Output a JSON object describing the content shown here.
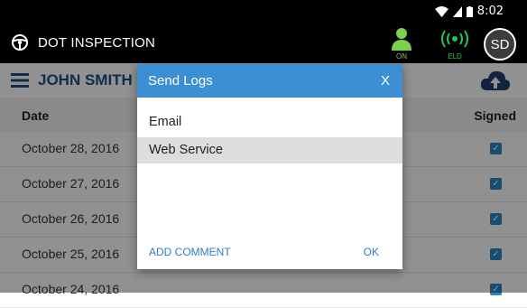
{
  "status_bar": {
    "time": "8:02",
    "icons": [
      "wifi-icon",
      "signal-icon",
      "battery-icon"
    ]
  },
  "app_bar": {
    "title": "DOT INSPECTION",
    "driver_status_label": "ON",
    "eld_label": "ELD",
    "avatar_initials": "SD",
    "colors": {
      "on_green": "#7ad14f",
      "eld_green": "#23c552"
    }
  },
  "toolbar": {
    "driver_name": "JOHN SMITH",
    "accent": "#1f4f86"
  },
  "table": {
    "headers": {
      "date": "Date",
      "signed": "Signed"
    },
    "rows": [
      {
        "date": "October 28, 2016",
        "signed": true
      },
      {
        "date": "October 27, 2016",
        "signed": true
      },
      {
        "date": "October 26, 2016",
        "signed": true
      },
      {
        "date": "October 25, 2016",
        "signed": true
      },
      {
        "date": "October 24, 2016",
        "signed": true
      }
    ]
  },
  "dialog": {
    "title": "Send Logs",
    "close_label": "X",
    "options": [
      "Email",
      "Web Service"
    ],
    "selected_option": "Web Service",
    "add_comment_label": "ADD COMMENT",
    "ok_label": "OK",
    "header_color": "#3c8fd2"
  }
}
